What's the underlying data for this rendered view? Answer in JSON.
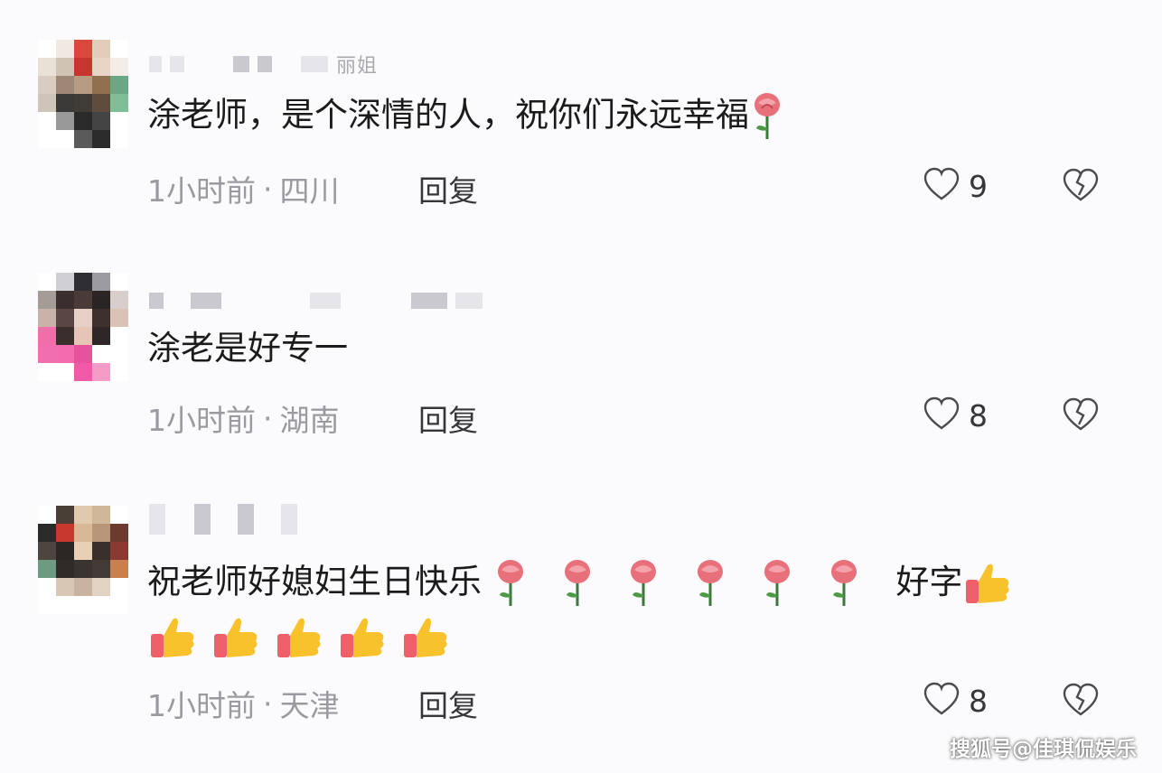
{
  "comments": [
    {
      "username_tail": "丽姐",
      "text": "涂老师，是个深情的人，祝你们永远幸福",
      "text_emojis": [
        "rose"
      ],
      "time": "1小时前",
      "location": "四川",
      "reply_label": "回复",
      "likes": "9"
    },
    {
      "username_tail": "",
      "text": "涂老是好专一",
      "text_emojis": [],
      "time": "1小时前",
      "location": "湖南",
      "reply_label": "回复",
      "likes": "8"
    },
    {
      "username_tail": "",
      "text": "祝老师好媳妇生日快乐",
      "text_emojis": [
        "rose",
        "rose",
        "rose",
        "rose",
        "rose",
        "rose"
      ],
      "text_suffix": "好字",
      "suffix_emojis": [
        "thumbs-up"
      ],
      "second_line_emojis": [
        "thumbs-up",
        "thumbs-up",
        "thumbs-up",
        "thumbs-up",
        "thumbs-up"
      ],
      "time": "1小时前",
      "location": "天津",
      "reply_label": "回复",
      "likes": "8"
    }
  ],
  "meta_separator": "·",
  "watermark": "搜狐号@佳琪侃娱乐",
  "icons": {
    "like": "heart-outline-icon",
    "dislike": "broken-heart-icon",
    "rose": "rose-emoji",
    "thumbs_up": "thumbs-up-emoji"
  },
  "colors": {
    "meta_text": "#9a9aa1",
    "body_text": "#1b1b1b",
    "rose": "#e8707a",
    "thumb": "#f7c22b"
  }
}
